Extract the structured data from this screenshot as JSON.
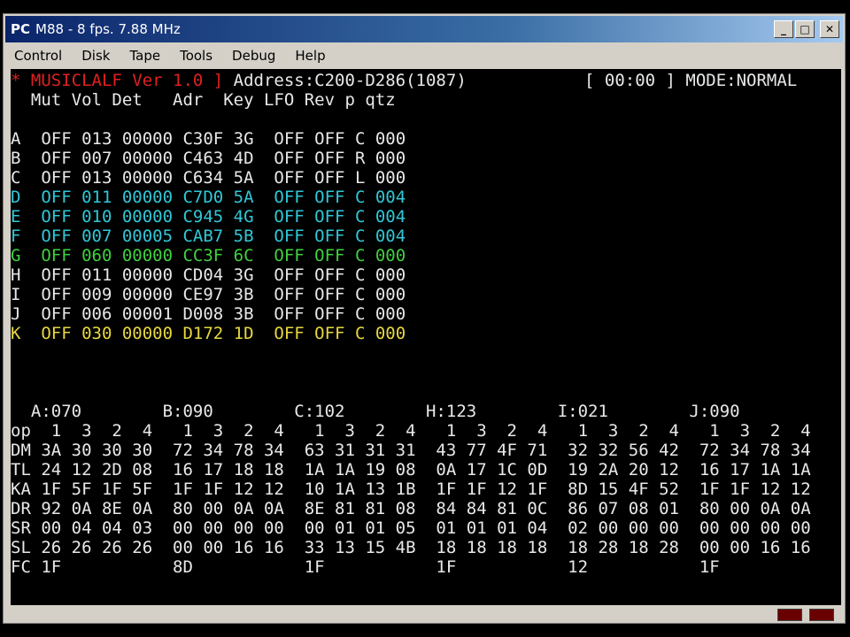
{
  "window": {
    "icon_label": "PC",
    "title": "M88 - 8 fps. 7.88 MHz"
  },
  "menu": [
    "Control",
    "Disk",
    "Tape",
    "Tools",
    "Debug",
    "Help"
  ],
  "screen": {
    "header_left": "* MUSICLALF Ver 1.0 ]",
    "header_address": " Address:C200-D286(1087)",
    "header_right": "[ 00:00 ] MODE:NORMAL",
    "columns": "  Mut Vol Det   Adr  Key LFO Rev p qtz",
    "channels": [
      {
        "ch": "A",
        "text": "  OFF 013 00000 C30F 3G  OFF OFF C 000",
        "color": "w"
      },
      {
        "ch": "B",
        "text": "  OFF 007 00000 C463 4D  OFF OFF R 000",
        "color": "w"
      },
      {
        "ch": "C",
        "text": "  OFF 013 00000 C634 5A  OFF OFF L 000",
        "color": "w"
      },
      {
        "ch": "D",
        "text": "  OFF 011 00000 C7D0 5A  OFF OFF C 004",
        "color": "c"
      },
      {
        "ch": "E",
        "text": "  OFF 010 00000 C945 4G  OFF OFF C 004",
        "color": "c"
      },
      {
        "ch": "F",
        "text": "  OFF 007 00005 CAB7 5B  OFF OFF C 004",
        "color": "c"
      },
      {
        "ch": "G",
        "text": "  OFF 060 00000 CC3F 6C  OFF OFF C 000",
        "color": "g"
      },
      {
        "ch": "H",
        "text": "  OFF 011 00000 CD04 3G  OFF OFF C 000",
        "color": "w"
      },
      {
        "ch": "I",
        "text": "  OFF 009 00000 CE97 3B  OFF OFF C 000",
        "color": "w"
      },
      {
        "ch": "J",
        "text": "  OFF 006 00001 D008 3B  OFF OFF C 000",
        "color": "w"
      },
      {
        "ch": "K",
        "text": "  OFF 030 00000 D172 1D  OFF OFF C 000",
        "color": "y"
      }
    ],
    "op_header": "  A:070        B:090        C:102        H:123        I:021        J:090",
    "op_rows": [
      "op  1  3  2  4   1  3  2  4   1  3  2  4   1  3  2  4   1  3  2  4   1  3  2  4",
      "DM 3A 30 30 30  72 34 78 34  63 31 31 31  43 77 4F 71  32 32 56 42  72 34 78 34",
      "TL 24 12 2D 08  16 17 18 18  1A 1A 19 08  0A 17 1C 0D  19 2A 20 12  16 17 1A 1A",
      "KA 1F 5F 1F 5F  1F 1F 12 12  10 1A 13 1B  1F 1F 12 1F  8D 15 4F 52  1F 1F 12 12",
      "DR 92 0A 8E 0A  80 00 0A 0A  8E 81 81 08  84 84 81 0C  86 07 08 01  80 00 0A 0A",
      "SR 00 04 04 03  00 00 00 00  00 01 01 05  01 01 01 04  02 00 00 00  00 00 00 00",
      "SL 26 26 26 26  00 00 16 16  33 13 15 4B  18 18 18 18  18 28 18 28  00 00 16 16",
      "FC 1F           8D           1F           1F           12           1F"
    ]
  }
}
